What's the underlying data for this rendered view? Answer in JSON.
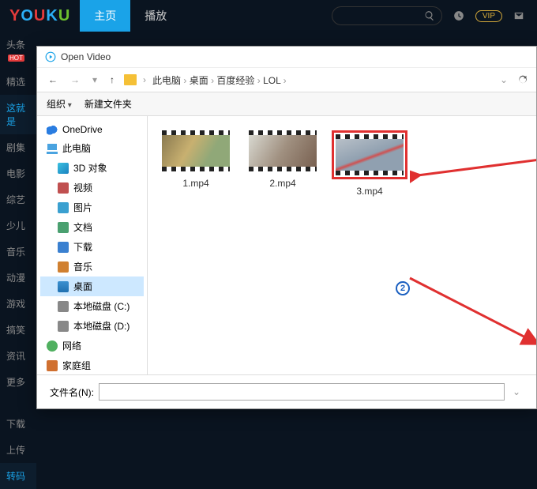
{
  "youku": {
    "tabs": {
      "main": "主页",
      "play": "播放"
    },
    "vip": "VIP",
    "nav": [
      "头条",
      "精选",
      "这就是",
      "剧集",
      "电影",
      "综艺",
      "少儿",
      "音乐",
      "动漫",
      "游戏",
      "搞笑",
      "资讯",
      "更多",
      "下载",
      "上传",
      "转码"
    ],
    "nav_hot_idx": 0,
    "nav_hl_idx": 2,
    "nav_hl_bottom_idx": 15
  },
  "dialog": {
    "title": "Open Video",
    "breadcrumbs": [
      "此电脑",
      "桌面",
      "百度经验",
      "LOL"
    ],
    "toolbar": {
      "org": "组织",
      "newfolder": "新建文件夹"
    },
    "tree": [
      {
        "label": "OneDrive",
        "lvl": 1,
        "icon": "ic-cloud"
      },
      {
        "label": "此电脑",
        "lvl": 1,
        "icon": "ic-pc"
      },
      {
        "label": "3D 对象",
        "lvl": 2,
        "icon": "ic-3d"
      },
      {
        "label": "视频",
        "lvl": 2,
        "icon": "ic-video"
      },
      {
        "label": "图片",
        "lvl": 2,
        "icon": "ic-pic"
      },
      {
        "label": "文档",
        "lvl": 2,
        "icon": "ic-doc"
      },
      {
        "label": "下载",
        "lvl": 2,
        "icon": "ic-down"
      },
      {
        "label": "音乐",
        "lvl": 2,
        "icon": "ic-music"
      },
      {
        "label": "桌面",
        "lvl": 2,
        "icon": "ic-desk",
        "selected": true
      },
      {
        "label": "本地磁盘 (C:)",
        "lvl": 2,
        "icon": "ic-disk"
      },
      {
        "label": "本地磁盘 (D:)",
        "lvl": 2,
        "icon": "ic-disk"
      },
      {
        "label": "网络",
        "lvl": 1,
        "icon": "ic-net"
      },
      {
        "label": "家庭组",
        "lvl": 1,
        "icon": "ic-home"
      }
    ],
    "files": [
      {
        "name": "1.mp4",
        "thumb": "t1"
      },
      {
        "name": "2.mp4",
        "thumb": "t2"
      },
      {
        "name": "3.mp4",
        "thumb": "t3",
        "selected": true
      }
    ],
    "filename_label": "文件名(N):",
    "filename_value": "",
    "annotation_number": "2"
  }
}
